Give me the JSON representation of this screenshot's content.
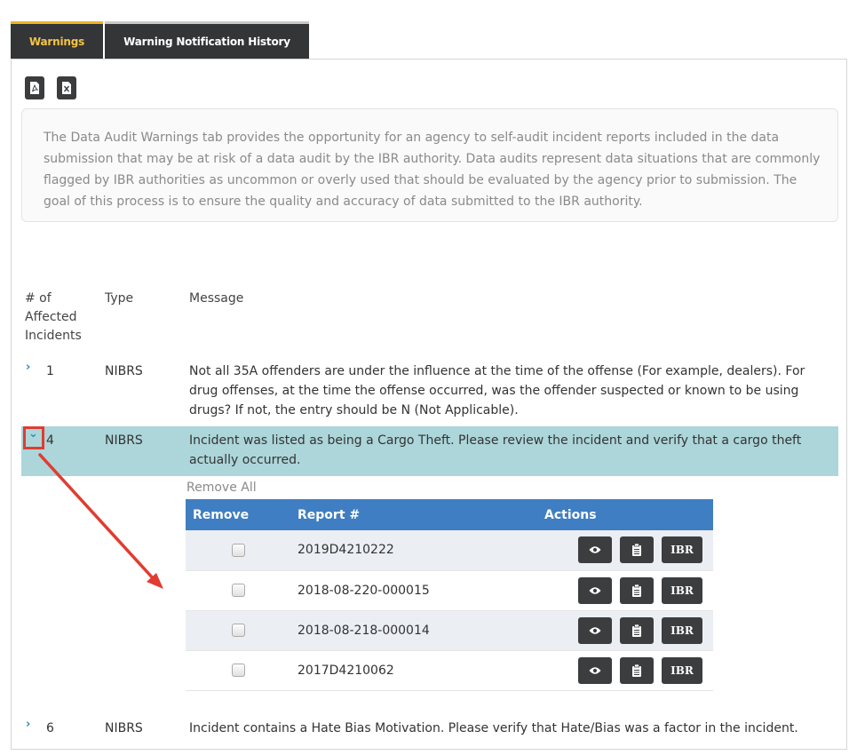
{
  "tabs": [
    {
      "label": "Warnings",
      "active": true
    },
    {
      "label": "Warning Notification History",
      "active": false
    }
  ],
  "export_buttons": [
    {
      "icon": "pdf-icon"
    },
    {
      "icon": "excel-icon"
    }
  ],
  "info_text": "The Data Audit Warnings tab provides the opportunity for an agency to self-audit incident reports included in the data submission that may be at risk of a data audit by the IBR authority. Data audits represent data situations that are commonly flagged by IBR authorities as uncommon or overly used that should be evaluated by the agency prior to submission. The goal of this process is to ensure the quality and accuracy of data submitted to the IBR authority.",
  "table_headers": {
    "count": "# of Affected Incidents",
    "type": "Type",
    "message": "Message"
  },
  "warnings": [
    {
      "count": "1",
      "type": "NIBRS",
      "message": "Not all 35A offenders are under the influence at the time of the offense (For example, dealers). For drug offenses, at the time the offense occurred, was the offender suspected or known to be using drugs?  If not, the entry should be N (Not Applicable).",
      "expanded": false
    },
    {
      "count": "4",
      "type": "NIBRS",
      "message": "Incident was listed as being a Cargo Theft. Please review the incident and verify that a cargo theft actually occurred.",
      "expanded": true
    },
    {
      "count": "6",
      "type": "NIBRS",
      "message": "Incident contains a Hate Bias Motivation. Please verify that Hate/Bias was a factor in the incident.",
      "expanded": false
    }
  ],
  "details": {
    "remove_all": "Remove All",
    "headers": {
      "remove": "Remove",
      "report": "Report #",
      "actions": "Actions"
    },
    "rows": [
      {
        "report": "2019D4210222"
      },
      {
        "report": "2018-08-220-000015"
      },
      {
        "report": "2018-08-218-000014"
      },
      {
        "report": "2017D4210062"
      }
    ],
    "action_labels": {
      "view_icon": "eye-icon",
      "clipboard_icon": "clipboard-icon",
      "ibr": "IBR"
    }
  },
  "colors": {
    "active_tab_text": "#f6c445",
    "tab_bg": "#333537",
    "table_header_bg": "#3f7ec2",
    "highlight_row": "#acd6da",
    "annotation_red": "#e03c31"
  }
}
